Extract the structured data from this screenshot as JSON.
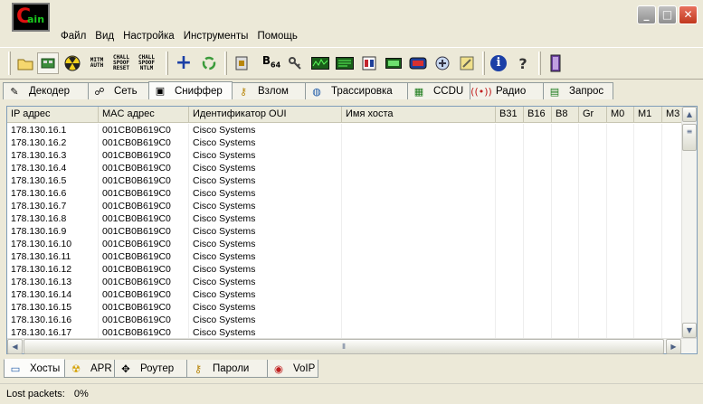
{
  "app": {
    "logo_text_c": "C",
    "logo_text_ain": "ain",
    "window_buttons": {
      "minimize": "_",
      "maximize": "□",
      "close": "✕"
    }
  },
  "menu": [
    "Файл",
    "Вид",
    "Настройка",
    "Инструменты",
    "Помощь"
  ],
  "toolbar": {
    "mitm_auth": [
      "MITM",
      "AUTH"
    ],
    "chall_spoof_reset": [
      "CHALL",
      "SPOOF",
      "RESET"
    ],
    "chall_spoof_ntlm": [
      "CHALL",
      "SPOOF",
      "NTLM"
    ],
    "b64": "B",
    "b64_sub": "64",
    "help_glyph": "?",
    "info_glyph": "i",
    "add_glyph": "+"
  },
  "tabs_top": [
    {
      "label": "Декодер",
      "icon": "decoder-icon",
      "active": false
    },
    {
      "label": "Сеть",
      "icon": "network-icon",
      "active": false
    },
    {
      "label": "Сниффер",
      "icon": "sniffer-icon",
      "active": true
    },
    {
      "label": "Взлом",
      "icon": "crack-icon",
      "active": false
    },
    {
      "label": "Трассировка",
      "icon": "traceroute-icon",
      "active": false
    },
    {
      "label": "CCDU",
      "icon": "ccdu-icon",
      "active": false
    },
    {
      "label": "Радио",
      "icon": "wireless-icon",
      "active": false
    },
    {
      "label": "Запрос",
      "icon": "query-icon",
      "active": false
    }
  ],
  "table": {
    "columns": [
      "IP адрес",
      "MAC адрес",
      "Идентификатор OUI",
      "Имя хоста",
      "B31",
      "B16",
      "B8",
      "Gr",
      "M0",
      "M1",
      "M3"
    ],
    "rows": [
      [
        "178.130.16.1",
        "001CB0B619C0",
        "Cisco Systems"
      ],
      [
        "178.130.16.2",
        "001CB0B619C0",
        "Cisco Systems"
      ],
      [
        "178.130.16.3",
        "001CB0B619C0",
        "Cisco Systems"
      ],
      [
        "178.130.16.4",
        "001CB0B619C0",
        "Cisco Systems"
      ],
      [
        "178.130.16.5",
        "001CB0B619C0",
        "Cisco Systems"
      ],
      [
        "178.130.16.6",
        "001CB0B619C0",
        "Cisco Systems"
      ],
      [
        "178.130.16.7",
        "001CB0B619C0",
        "Cisco Systems"
      ],
      [
        "178.130.16.8",
        "001CB0B619C0",
        "Cisco Systems"
      ],
      [
        "178.130.16.9",
        "001CB0B619C0",
        "Cisco Systems"
      ],
      [
        "178.130.16.10",
        "001CB0B619C0",
        "Cisco Systems"
      ],
      [
        "178.130.16.11",
        "001CB0B619C0",
        "Cisco Systems"
      ],
      [
        "178.130.16.12",
        "001CB0B619C0",
        "Cisco Systems"
      ],
      [
        "178.130.16.13",
        "001CB0B619C0",
        "Cisco Systems"
      ],
      [
        "178.130.16.14",
        "001CB0B619C0",
        "Cisco Systems"
      ],
      [
        "178.130.16.15",
        "001CB0B619C0",
        "Cisco Systems"
      ],
      [
        "178.130.16.16",
        "001CB0B619C0",
        "Cisco Systems"
      ],
      [
        "178.130.16.17",
        "001CB0B619C0",
        "Cisco Systems"
      ]
    ]
  },
  "tabs_bottom": [
    {
      "label": "Хосты",
      "icon": "hosts-icon",
      "active": true
    },
    {
      "label": "APR",
      "icon": "apr-icon",
      "active": false
    },
    {
      "label": "Роутер",
      "icon": "router-icon",
      "active": false
    },
    {
      "label": "Пароли",
      "icon": "passwords-icon",
      "active": false
    },
    {
      "label": "VoIP",
      "icon": "voip-icon",
      "active": false
    }
  ],
  "status": {
    "lost_packets_label": "Lost packets:",
    "lost_packets_value": "0%"
  },
  "colors": {
    "window_bg": "#ece9d8",
    "close_button": "#c1381e",
    "logo_red": "#e01010",
    "logo_green": "#19c81e"
  }
}
